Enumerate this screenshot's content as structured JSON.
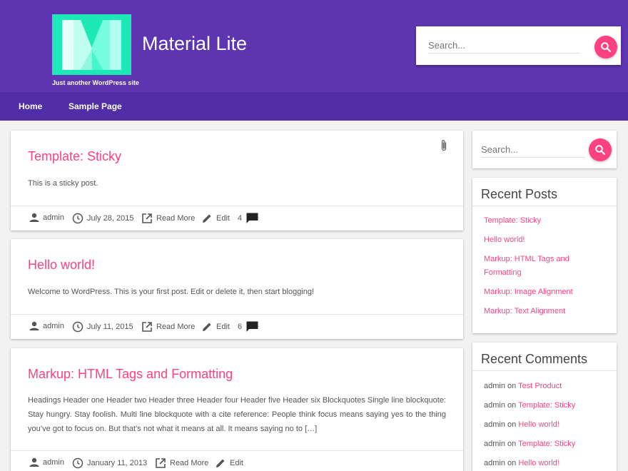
{
  "site": {
    "title": "Material Lite",
    "tagline": "Just another WordPress site",
    "search_placeholder": "Search..."
  },
  "colors": {
    "header": "#5e35b1",
    "nav": "#512da8",
    "accent": "#ff4081",
    "logo_bg": "#1de9b6"
  },
  "nav": {
    "items": [
      {
        "label": "Home"
      },
      {
        "label": "Sample Page"
      }
    ]
  },
  "posts": [
    {
      "title": "Template: Sticky",
      "excerpt": "This is a sticky post.",
      "author": "admin",
      "date": "July 28, 2015",
      "read_more": "Read More",
      "edit": "Edit",
      "comments": "4",
      "sticky_icon": "paperclip-icon"
    },
    {
      "title": "Hello world!",
      "excerpt": "Welcome to WordPress. This is your first post. Edit or delete it, then start blogging!",
      "author": "admin",
      "date": "July 11, 2015",
      "read_more": "Read More",
      "edit": "Edit",
      "comments": "6"
    },
    {
      "title": "Markup: HTML Tags and Formatting",
      "excerpt": "Headings Header one Header two Header three Header four Header five Header six Blockquotes Single line blockquote: Stay hungry. Stay foolish. Multi line blockquote with a cite reference: People think focus means saying yes to the thing you’ve got to focus on. But that’s not what it means at all. It means saying no to […]",
      "author": "admin",
      "date": "January 11, 2013",
      "read_more": "Read More",
      "edit": "Edit"
    }
  ],
  "sidebar": {
    "search_placeholder": "Search...",
    "recent_posts": {
      "title": "Recent Posts",
      "items": [
        {
          "label": "Template: Sticky"
        },
        {
          "label": "Hello world!"
        },
        {
          "label": "Markup: HTML Tags and Formatting"
        },
        {
          "label": "Markup: Image Alignment"
        },
        {
          "label": "Markup: Text Alignment"
        }
      ]
    },
    "recent_comments": {
      "title": "Recent Comments",
      "connector": "on",
      "items": [
        {
          "author": "admin",
          "post": "Test Product"
        },
        {
          "author": "admin",
          "post": "Template: Sticky"
        },
        {
          "author": "admin",
          "post": "Hello world!"
        },
        {
          "author": "admin",
          "post": "Template: Sticky"
        },
        {
          "author": "admin",
          "post": "Hello world!"
        }
      ]
    }
  }
}
